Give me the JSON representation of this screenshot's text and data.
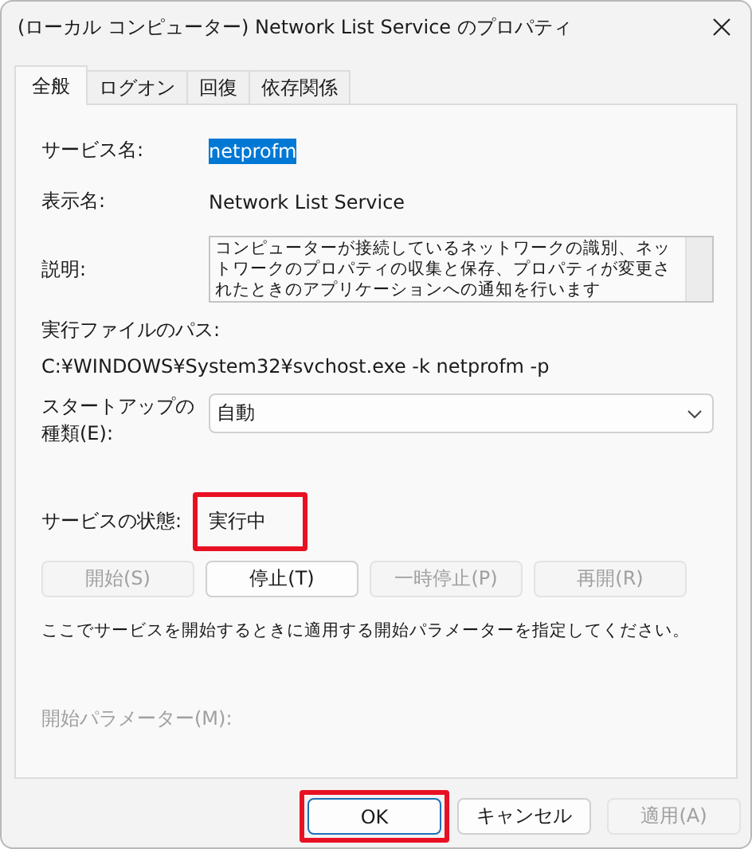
{
  "window": {
    "title": "(ローカル コンピューター) Network List Service のプロパティ"
  },
  "tabs": [
    {
      "label": "全般",
      "selected": true
    },
    {
      "label": "ログオン",
      "selected": false
    },
    {
      "label": "回復",
      "selected": false
    },
    {
      "label": "依存関係",
      "selected": false
    }
  ],
  "service_name": {
    "label": "サービス名:",
    "value": "netprofm",
    "selected": true
  },
  "display_name": {
    "label": "表示名:",
    "value": "Network List Service"
  },
  "description": {
    "label": "説明:",
    "value": "コンピューターが接続しているネットワークの識別、ネットワークのプロパティの収集と保存、プロパティが変更されたときのアプリケーションへの通知を行います"
  },
  "executable_path": {
    "label": "実行ファイルのパス:",
    "value": "C:¥WINDOWS¥System32¥svchost.exe -k netprofm -p"
  },
  "startup_type": {
    "label": "スタートアップの種類(E):",
    "value": "自動"
  },
  "service_status": {
    "label": "サービスの状態:",
    "value": "実行中",
    "highlighted": true
  },
  "service_buttons": [
    {
      "label": "開始(S)",
      "disabled": true
    },
    {
      "label": "停止(T)",
      "disabled": false
    },
    {
      "label": "一時停止(P)",
      "disabled": true
    },
    {
      "label": "再開(R)",
      "disabled": true
    }
  ],
  "hint": "ここでサービスを開始するときに適用する開始パラメーターを指定してください。",
  "start_parameters": {
    "label": "開始パラメーター(M):",
    "disabled": true
  },
  "dialog_buttons": [
    {
      "label": "OK",
      "disabled": false,
      "default": true,
      "highlighted": true
    },
    {
      "label": "キャンセル",
      "disabled": false,
      "default": false,
      "highlighted": false
    },
    {
      "label": "適用(A)",
      "disabled": true,
      "default": false,
      "highlighted": false
    }
  ]
}
